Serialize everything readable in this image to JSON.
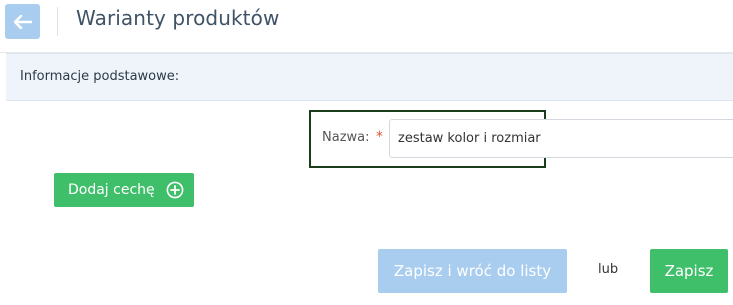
{
  "header": {
    "title": "Warianty produktów",
    "back_icon": "arrow-left-icon"
  },
  "section": {
    "title": "Informacje podstawowe:"
  },
  "form": {
    "name_label": "Nazwa:",
    "required_mark": "*",
    "name_value": "zestaw kolor i rozmiar"
  },
  "actions": {
    "add_trait_label": "Dodaj cechę",
    "add_trait_icon": "plus-circle-icon",
    "save_return_label": "Zapisz i wróć do listy",
    "or_label": "lub",
    "save_label": "Zapisz"
  },
  "colors": {
    "primary_light": "#a9cdef",
    "success": "#3fbf6a",
    "required": "#e0533a",
    "title": "#3f5266"
  }
}
